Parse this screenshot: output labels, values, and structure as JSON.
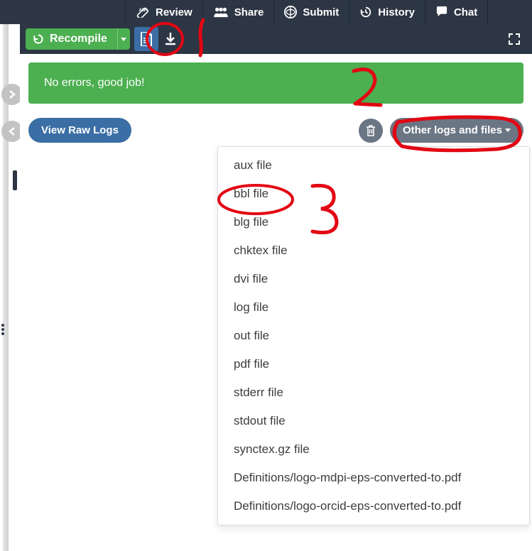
{
  "topnav": {
    "items": [
      {
        "label": "Review"
      },
      {
        "label": "Share"
      },
      {
        "label": "Submit"
      },
      {
        "label": "History"
      },
      {
        "label": "Chat"
      }
    ]
  },
  "toolbar": {
    "recompile_label": "Recompile"
  },
  "status": {
    "message": "No errors, good job!"
  },
  "actions": {
    "view_logs_label": "View Raw Logs",
    "other_logs_label": "Other logs and files"
  },
  "dropdown": {
    "items": [
      "aux file",
      "bbl file",
      "blg file",
      "chktex file",
      "dvi file",
      "log file",
      "out file",
      "pdf file",
      "stderr file",
      "stdout file",
      "synctex.gz file",
      "Definitions/logo-mdpi-eps-converted-to.pdf",
      "Definitions/logo-orcid-eps-converted-to.pdf"
    ]
  },
  "annotations": {
    "1": "1",
    "2": "2",
    "3": "3"
  }
}
